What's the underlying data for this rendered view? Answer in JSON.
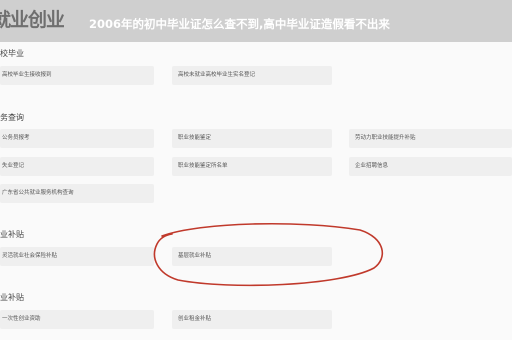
{
  "header": {
    "brand": "就业创业",
    "headline": "2006年的初中毕业证怎么查不到,高中毕业证造假看不出来"
  },
  "sections": [
    {
      "title": "校毕业",
      "items": [
        "高校毕业生接收报到",
        "高校未就业高校毕业生实名登记"
      ]
    },
    {
      "title": "务查询",
      "items": [
        "公务员报考",
        "职业技能鉴定",
        "劳动力职业技能提升补贴",
        "失业登记",
        "职业技能鉴定所名单",
        "企业招聘信息",
        "广东省公共就业服务机构查询"
      ]
    },
    {
      "title": "业补贴",
      "items": [
        "灵活就业社会保险补贴",
        "基层就业补贴"
      ]
    },
    {
      "title": "业补贴",
      "items": [
        "一次性创业资助",
        "创业租金补贴"
      ]
    }
  ],
  "annotation": {
    "color": "#c0392b",
    "shape": "hand-drawn ellipse"
  }
}
